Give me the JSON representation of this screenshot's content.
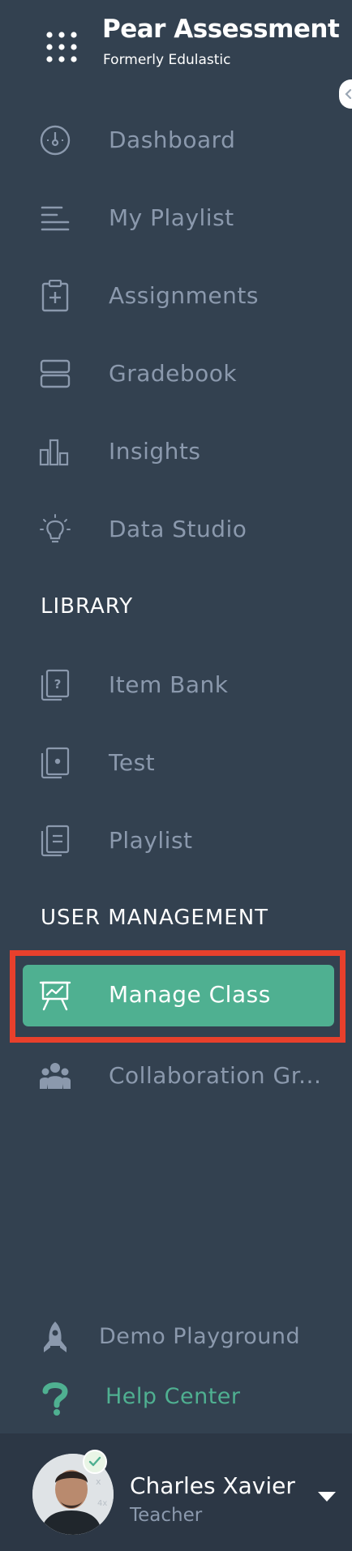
{
  "brand": {
    "title": "Pear Assessment",
    "subtitle": "Formerly Edulastic"
  },
  "nav": {
    "items": [
      {
        "label": "Dashboard",
        "icon": "dashboard-icon"
      },
      {
        "label": "My Playlist",
        "icon": "playlist-lines-icon"
      },
      {
        "label": "Assignments",
        "icon": "clipboard-plus-icon"
      },
      {
        "label": "Gradebook",
        "icon": "gradebook-icon"
      },
      {
        "label": "Insights",
        "icon": "bar-chart-icon"
      },
      {
        "label": "Data Studio",
        "icon": "lightbulb-icon"
      }
    ]
  },
  "library": {
    "heading": "LIBRARY",
    "items": [
      {
        "label": "Item Bank",
        "icon": "question-cards-icon"
      },
      {
        "label": "Test",
        "icon": "test-cards-icon"
      },
      {
        "label": "Playlist",
        "icon": "playlist-cards-icon"
      }
    ]
  },
  "user_management": {
    "heading": "USER MANAGEMENT",
    "items": [
      {
        "label": "Manage Class",
        "icon": "presentation-board-icon",
        "active": true
      },
      {
        "label": "Collaboration Gr...",
        "icon": "group-icon"
      }
    ]
  },
  "bottom_links": {
    "demo": {
      "label": "Demo Playground",
      "icon": "rocket-icon"
    },
    "help": {
      "label": "Help Center",
      "icon": "question-mark-icon"
    }
  },
  "user": {
    "name": "Charles Xavier",
    "role": "Teacher"
  },
  "colors": {
    "sidebar_bg": "#334150",
    "footer_bg": "#2c3745",
    "accent": "#4fb091",
    "highlight_outline": "#e8402c",
    "muted_text": "#8b99ad",
    "heading_text": "#ffffff"
  }
}
